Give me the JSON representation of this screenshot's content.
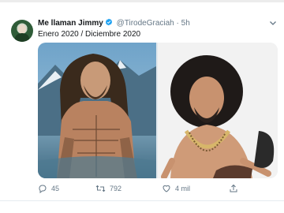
{
  "tweet": {
    "author_name": "Me llaman Jimmy",
    "handle": "@TirodeGraciah",
    "separator": "·",
    "time": "5h",
    "text": "Enero 2020 / Diciembre 2020"
  },
  "actions": {
    "reply_count": "45",
    "retweet_count": "792",
    "like_count": "4 mil"
  },
  "icons": [
    "avatar",
    "verified-badge-icon",
    "chevron-down-icon",
    "reply-icon",
    "retweet-icon",
    "like-icon",
    "share-icon"
  ],
  "colors": {
    "text_primary": "#14171a",
    "text_secondary": "#657786",
    "verified": "#1da1f2"
  }
}
